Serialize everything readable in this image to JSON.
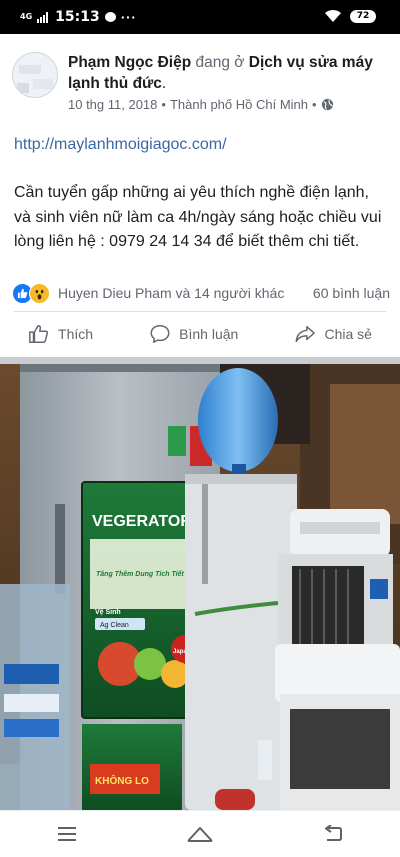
{
  "status_bar": {
    "network": "4G",
    "time": "15:13",
    "more": "···",
    "battery": "72",
    "icons": [
      "signal-icon",
      "message-icon",
      "wifi-icon",
      "battery-icon"
    ]
  },
  "post": {
    "author": "Phạm Ngọc Điệp",
    "location_prefix": "đang ở",
    "location": "Dịch vụ sửa máy lạnh thủ đức",
    "location_suffix": ".",
    "date": "10 thg 11, 2018",
    "separator": "•",
    "city": "Thành phố Hồ Chí Minh",
    "separator2": "•",
    "privacy_icon": "globe-icon",
    "menu": "···",
    "link": "http://maylanhmoigiagoc.com/",
    "text": "Cần tuyển gấp những ai yêu thích nghề điện lạnh, và sinh viên nữ làm ca 4h/ngày sáng hoặc chiều vui lòng liên hệ : 0979 24 14 34 để biết thêm chi tiết.",
    "reactions": {
      "icons": [
        "like-reaction-icon",
        "wow-reaction-icon"
      ],
      "reactors": "Huyen Dieu Pham và 14 người khác",
      "comments": "60 bình luận"
    },
    "actions": {
      "like": "Thích",
      "comment": "Bình luận",
      "share": "Chia sẻ"
    },
    "photo": {
      "brand_label": "VEGERATOR",
      "side_panel_text": "KHÔNG LO",
      "feature_label": "Vệ Sinh",
      "tag_label": "Ag Clean",
      "tech_badge": "Japan",
      "banner_text": "Tăng Thêm Dung Tích Tiết Kiệm Gấp Đôi"
    }
  },
  "navigation": {
    "menu_icon": "menu-icon",
    "home_icon": "home-icon",
    "back_icon": "back-icon"
  }
}
